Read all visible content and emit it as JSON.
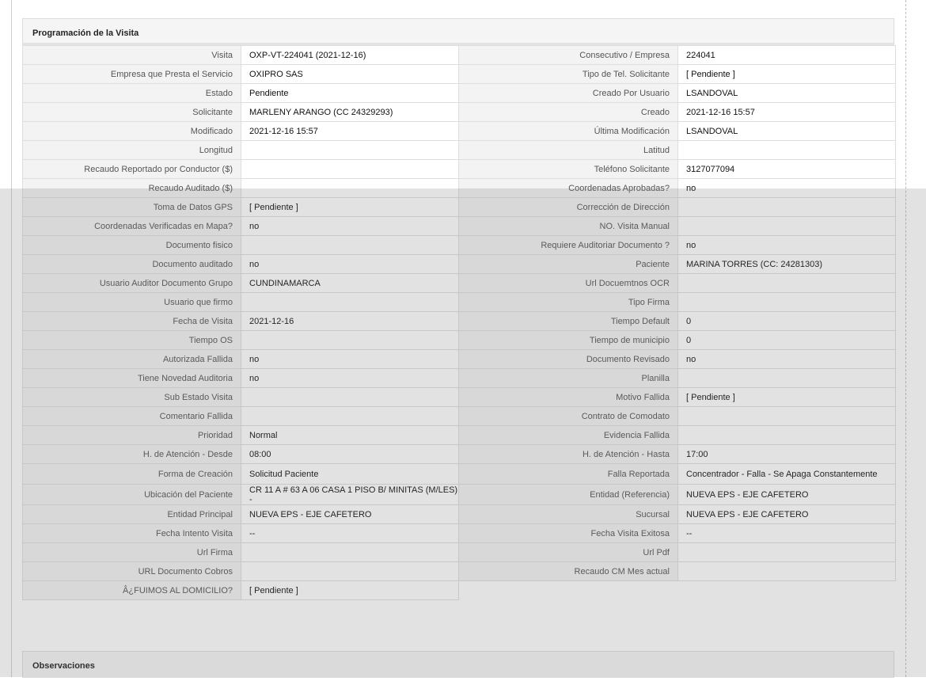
{
  "section_title": "Programación de la Visita",
  "rows": [
    {
      "l1": "Visita",
      "v1": "OXP-VT-224041 (2021-12-16)",
      "l2": "Consecutivo / Empresa",
      "v2": "224041"
    },
    {
      "l1": "Empresa que Presta el Servicio",
      "v1": "OXIPRO SAS",
      "l2": "Tipo de Tel. Solicitante",
      "v2": "[ Pendiente ]"
    },
    {
      "l1": "Estado",
      "v1": "Pendiente",
      "l2": "Creado Por Usuario",
      "v2": "LSANDOVAL"
    },
    {
      "l1": "Solicitante",
      "v1": "MARLENY ARANGO (CC 24329293)",
      "l2": "Creado",
      "v2": "2021-12-16 15:57"
    },
    {
      "l1": "Modificado",
      "v1": "2021-12-16 15:57",
      "l2": "Última Modificación",
      "v2": "LSANDOVAL"
    },
    {
      "l1": "Longitud",
      "v1": "",
      "l2": "Latitud",
      "v2": ""
    },
    {
      "l1": "Recaudo Reportado por Conductor ($)",
      "v1": "",
      "l2": "Teléfono Solicitante",
      "v2": "3127077094"
    },
    {
      "l1": "Recaudo Auditado ($)",
      "v1": "",
      "l2": "Coordenadas Aprobadas?",
      "v2": "no"
    },
    {
      "l1": "Toma de Datos GPS",
      "v1": "[ Pendiente ]",
      "l2": "Corrección de Dirección",
      "v2": ""
    },
    {
      "l1": "Coordenadas Verificadas en Mapa?",
      "v1": "no",
      "l2": "NO. Visita Manual",
      "v2": ""
    },
    {
      "l1": "Documento fisico",
      "v1": "",
      "l2": "Requiere Auditoriar Documento ?",
      "v2": "no"
    },
    {
      "l1": "Documento auditado",
      "v1": "no",
      "l2": "Paciente",
      "v2": "MARINA TORRES (CC: 24281303)"
    },
    {
      "l1": "Usuario Auditor Documento Grupo",
      "v1": "CUNDINAMARCA",
      "l2": "Url Docuemtnos OCR",
      "v2": ""
    },
    {
      "l1": "Usuario que firmo",
      "v1": "",
      "l2": "Tipo Firma",
      "v2": ""
    },
    {
      "l1": "Fecha de Visita",
      "v1": "2021-12-16",
      "l2": "Tiempo Default",
      "v2": "0"
    },
    {
      "l1": "Tiempo OS",
      "v1": "",
      "l2": "Tiempo de municipio",
      "v2": "0"
    },
    {
      "l1": "Autorizada Fallida",
      "v1": "no",
      "l2": "Documento Revisado",
      "v2": "no"
    },
    {
      "l1": "Tiene Novedad Auditoria",
      "v1": "no",
      "l2": "Planilla",
      "v2": ""
    },
    {
      "l1": "Sub Estado Visita",
      "v1": "",
      "l2": "Motivo Fallida",
      "v2": "[ Pendiente ]"
    },
    {
      "l1": "Comentario Fallida",
      "v1": "",
      "l2": "Contrato de Comodato",
      "v2": ""
    },
    {
      "l1": "Prioridad",
      "v1": "Normal",
      "l2": "Evidencia Fallida",
      "v2": ""
    },
    {
      "l1": "H. de Atención - Desde",
      "v1": "08:00",
      "l2": "H. de Atención - Hasta",
      "v2": "17:00"
    },
    {
      "l1": "Forma de Creación",
      "v1": "Solicitud Paciente",
      "l2": "Falla Reportada",
      "v2": "Concentrador - Falla - Se Apaga Constantemente"
    },
    {
      "l1": "Ubicación del Paciente",
      "v1": "CR 11 A # 63 A 06 CASA 1 PISO B/ MINITAS (M/LES) -",
      "l2": "Entidad (Referencia)",
      "v2": "NUEVA EPS - EJE CAFETERO"
    },
    {
      "l1": "Entidad Principal",
      "v1": "NUEVA EPS - EJE CAFETERO",
      "l2": "Sucursal",
      "v2": "NUEVA EPS - EJE CAFETERO"
    },
    {
      "l1": "Fecha Intento Visita",
      "v1": "--",
      "l2": "Fecha Visita Exitosa",
      "v2": "--"
    },
    {
      "l1": "Url Firma",
      "v1": "",
      "l2": "Url Pdf",
      "v2": ""
    },
    {
      "l1": "URL Documento Cobros",
      "v1": "",
      "l2": "Recaudo CM Mes actual",
      "v2": ""
    }
  ],
  "last_row": {
    "l1": "Â¿FUIMOS AL DOMICILIO?",
    "v1": "[ Pendiente ]"
  },
  "observaciones_title": "Observaciones",
  "colors": {
    "label_bg": "#f3f3f3",
    "border": "#dedede",
    "header_bg": "#f5f5f5",
    "overlay": "rgba(110,110,110,0.20)"
  }
}
